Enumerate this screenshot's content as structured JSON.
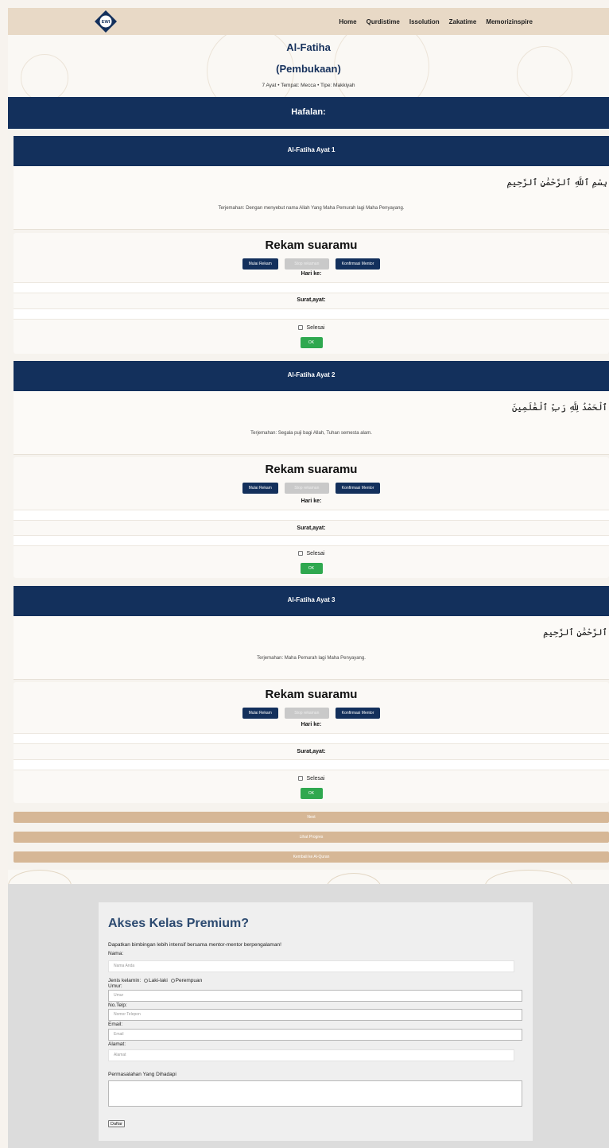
{
  "nav": {
    "logo_text": "EWI",
    "links": [
      "Home",
      "Qurdistime",
      "Issolution",
      "Zakatime",
      "Memorizinspire"
    ]
  },
  "hero": {
    "title": "Al-Fatiha",
    "subtitle": "(Pembukaan)",
    "meta": "7 Ayat • Tempat: Mecca • Tipe: Makkiyah"
  },
  "hafalan_title": "Hafalan:",
  "ayat": [
    {
      "heading": "Al-Fatiha Ayat 1",
      "arabic": "بِسْمِ ٱللَّهِ ٱلرَّحْمَٰنِ ٱلرَّحِيمِ",
      "translation": "Terjemahan: Dengan menyebut nama Allah Yang Maha Pemurah lagi Maha Penyayang."
    },
    {
      "heading": "Al-Fatiha Ayat 2",
      "arabic": "ٱلْحَمْدُ لِلَّهِ رَبِّ ٱلْعَٰلَمِينَ",
      "translation": "Terjemahan: Segala puji bagi Allah, Tuhan semesta alam."
    },
    {
      "heading": "Al-Fatiha Ayat 3",
      "arabic": "ٱلرَّحْمَٰنِ ٱلرَّحِيمِ",
      "translation": "Terjemahan: Maha Pemurah lagi Maha Penyayang."
    }
  ],
  "rekam": {
    "title": "Rekam suaramu",
    "start": "Mulai Rekam",
    "stop": "Stop rekaman",
    "confirm": "Konfirmasi Mentor",
    "day_label": "Hari ke:",
    "surah_label": "Surat,ayat:",
    "done_label": "Selesai",
    "ok": "OK"
  },
  "actions": {
    "next": "Next",
    "progress": "Lihat Progres",
    "back": "Kembali ke Al-Quran"
  },
  "premium": {
    "title": "Akses Kelas Premium?",
    "description": "Dapatkan bimbingan lebih intensif bersama mentor-mentor berpengalaman!",
    "name_label": "Nama:",
    "name_placeholder": "Nama Anda",
    "gender_label": "Jenis kelamin:",
    "gender_male": "Laki-laki",
    "gender_female": "Perempuan",
    "age_label": "Umur:",
    "age_placeholder": "Umur",
    "phone_label": "No.Telp:",
    "phone_placeholder": "Nomor Telepon",
    "email_label": "Email:",
    "email_placeholder": "Email",
    "address_label": "Alamat:",
    "address_placeholder": "Alamat",
    "problem_label": "Permasalahan Yang Dihadapi",
    "submit": "Daftar"
  },
  "colors": {
    "navy": "#13305c",
    "tan": "#d6b796",
    "green": "#2fa84f",
    "nav_bg": "#e8d9c6"
  }
}
